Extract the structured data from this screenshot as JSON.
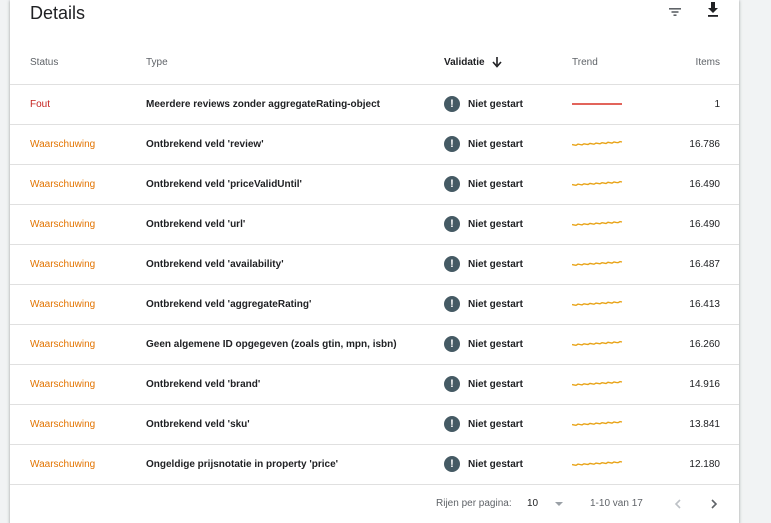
{
  "panel": {
    "title": "Details"
  },
  "toolbar": {
    "filter_icon": "filter-icon",
    "download_icon": "download-icon"
  },
  "columns": {
    "status": "Status",
    "type": "Type",
    "validation": "Validatie",
    "trend": "Trend",
    "items": "Items"
  },
  "colors": {
    "error": "#c5221f",
    "warning": "#e37400",
    "trend_error": "#d93025",
    "trend_warning": "#e8a317"
  },
  "rows": [
    {
      "status": "Fout",
      "severity": "error",
      "type": "Meerdere reviews zonder aggregateRating-object",
      "validation": "Niet gestart",
      "items": "1"
    },
    {
      "status": "Waarschuwing",
      "severity": "warning",
      "type": "Ontbrekend veld 'review'",
      "validation": "Niet gestart",
      "items": "16.786"
    },
    {
      "status": "Waarschuwing",
      "severity": "warning",
      "type": "Ontbrekend veld 'priceValidUntil'",
      "validation": "Niet gestart",
      "items": "16.490"
    },
    {
      "status": "Waarschuwing",
      "severity": "warning",
      "type": "Ontbrekend veld 'url'",
      "validation": "Niet gestart",
      "items": "16.490"
    },
    {
      "status": "Waarschuwing",
      "severity": "warning",
      "type": "Ontbrekend veld 'availability'",
      "validation": "Niet gestart",
      "items": "16.487"
    },
    {
      "status": "Waarschuwing",
      "severity": "warning",
      "type": "Ontbrekend veld 'aggregateRating'",
      "validation": "Niet gestart",
      "items": "16.413"
    },
    {
      "status": "Waarschuwing",
      "severity": "warning",
      "type": "Geen algemene ID opgegeven (zoals gtin, mpn, isbn)",
      "validation": "Niet gestart",
      "items": "16.260"
    },
    {
      "status": "Waarschuwing",
      "severity": "warning",
      "type": "Ontbrekend veld 'brand'",
      "validation": "Niet gestart",
      "items": "14.916"
    },
    {
      "status": "Waarschuwing",
      "severity": "warning",
      "type": "Ontbrekend veld 'sku'",
      "validation": "Niet gestart",
      "items": "13.841"
    },
    {
      "status": "Waarschuwing",
      "severity": "warning",
      "type": "Ongeldige prijsnotatie in property 'price'",
      "validation": "Niet gestart",
      "items": "12.180"
    }
  ],
  "pagination": {
    "rows_per_page_label": "Rijen per pagina:",
    "rows_per_page_value": "10",
    "range": "1-10 van 17"
  }
}
